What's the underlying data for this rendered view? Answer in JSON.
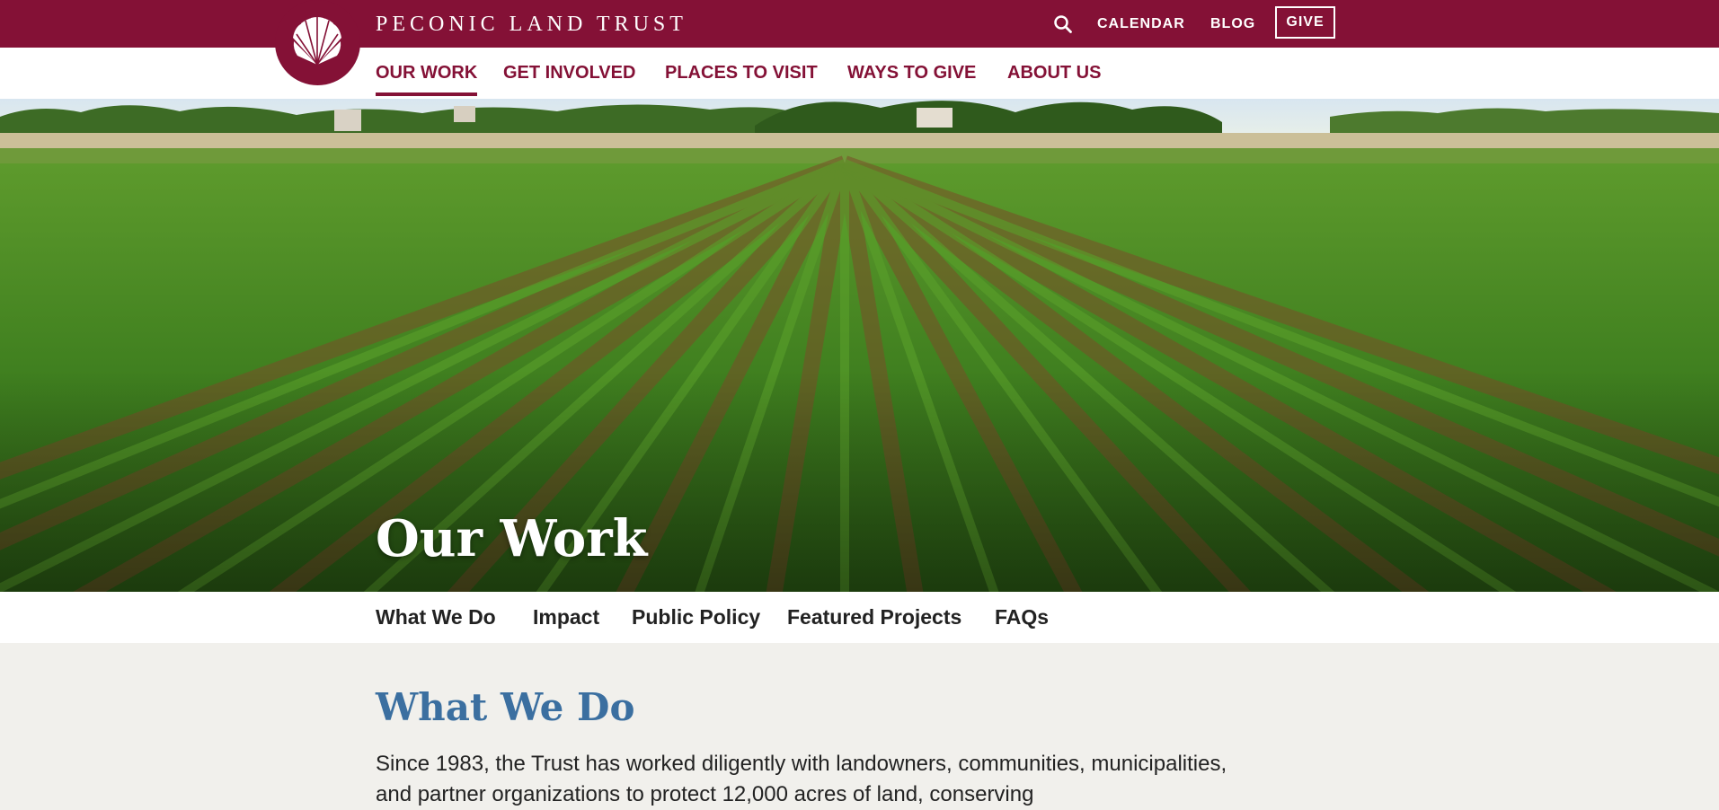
{
  "header": {
    "brand": "PECONIC LAND TRUST",
    "utility": {
      "calendar_label": "CALENDAR",
      "blog_label": "BLOG",
      "give_label": "GIVE"
    }
  },
  "nav": {
    "items": [
      {
        "label": "OUR WORK",
        "active": true
      },
      {
        "label": "GET INVOLVED"
      },
      {
        "label": "PLACES TO VISIT"
      },
      {
        "label": "WAYS TO GIVE"
      },
      {
        "label": "ABOUT US"
      }
    ]
  },
  "hero": {
    "title": "Our Work"
  },
  "subnav": {
    "items": [
      "What We Do",
      "Impact",
      "Public Policy",
      "Featured Projects",
      "FAQs"
    ]
  },
  "section": {
    "title": "What We Do",
    "body": "Since 1983, the Trust has worked diligently with landowners, communities, municipalities, and partner organizations to protect 12,000 acres of land, conserving"
  },
  "icons": {
    "search": "search-icon",
    "logo": "scallop-shell-logo"
  },
  "colors": {
    "brand": "#841136",
    "heading_blue": "#3b6fa0",
    "content_bg": "#f1f0ec"
  }
}
